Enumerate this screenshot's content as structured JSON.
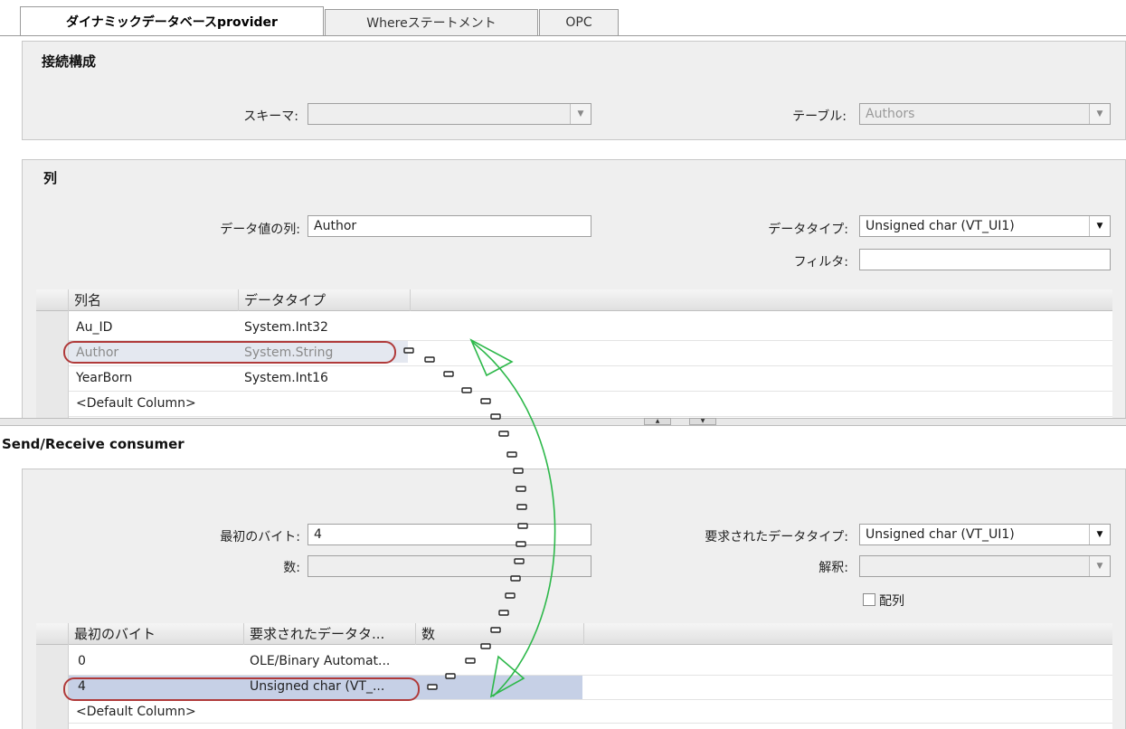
{
  "tabs": [
    {
      "label": "ダイナミックデータベースprovider"
    },
    {
      "label": "Whereステートメント"
    },
    {
      "label": "OPC"
    }
  ],
  "connection": {
    "title": "接続構成",
    "schema_label": "スキーマ:",
    "schema_value": "",
    "table_label": "テーブル:",
    "table_value": "Authors"
  },
  "columns": {
    "title": "列",
    "value_col_label": "データ値の列:",
    "value_col_value": "Author",
    "datatype_label": "データタイプ:",
    "datatype_value": "Unsigned char (VT_UI1)",
    "filter_label": "フィルタ:",
    "filter_value": "",
    "grid_headers": [
      "列名",
      "データタイプ"
    ],
    "rows": [
      {
        "name": "Au_ID",
        "type": "System.Int32"
      },
      {
        "name": "Author",
        "type": "System.String"
      },
      {
        "name": "YearBorn",
        "type": "System.Int16"
      },
      {
        "name": "<Default Column>",
        "type": ""
      }
    ]
  },
  "consumer": {
    "title": "Send/Receive consumer",
    "first_byte_label": "最初のバイト:",
    "first_byte_value": "4",
    "count_label": "数:",
    "count_value": "",
    "req_type_label": "要求されたデータタイプ:",
    "req_type_value": "Unsigned char (VT_UI1)",
    "interp_label": "解釈:",
    "interp_value": "",
    "array_label": "配列",
    "grid_headers": [
      "最初のバイト",
      "要求されたデータタ...",
      "数"
    ],
    "rows": [
      {
        "first": "0",
        "type": "OLE/Binary Automat...",
        "count": ""
      },
      {
        "first": "4",
        "type": "Unsigned char (VT_...",
        "count": ""
      },
      {
        "first": "<Default Column>",
        "type": "",
        "count": ""
      }
    ]
  },
  "colors": {
    "selection": "#c6d0e6",
    "highlight_oval": "#b03a3a",
    "arrow": "#2db84a"
  }
}
